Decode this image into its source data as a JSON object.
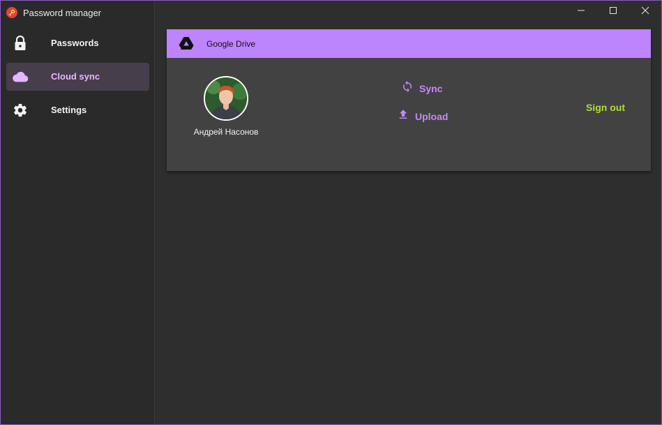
{
  "app": {
    "title": "Password manager",
    "logo_icon": "key-logo-icon"
  },
  "window_controls": {
    "minimize_icon": "minimize-icon",
    "maximize_icon": "maximize-icon",
    "close_icon": "close-icon"
  },
  "sidebar": {
    "items": [
      {
        "label": "Passwords",
        "icon": "lock-icon",
        "active": false
      },
      {
        "label": "Cloud sync",
        "icon": "cloud-icon",
        "active": true
      },
      {
        "label": "Settings",
        "icon": "gear-icon",
        "active": false
      }
    ]
  },
  "cloud_card": {
    "provider": "Google Drive",
    "provider_icon": "google-drive-icon",
    "user_name": "Андрей Насонов",
    "actions": {
      "sync_label": "Sync",
      "upload_label": "Upload",
      "sign_out_label": "Sign out"
    }
  },
  "colors": {
    "accent": "#bd84fd",
    "accent_text": "#c189fb",
    "sign_out": "#a8e22e",
    "active_nav_bg": "#463e4b",
    "active_nav_text": "#e3b8ff",
    "window_border": "#8b5ec4"
  }
}
